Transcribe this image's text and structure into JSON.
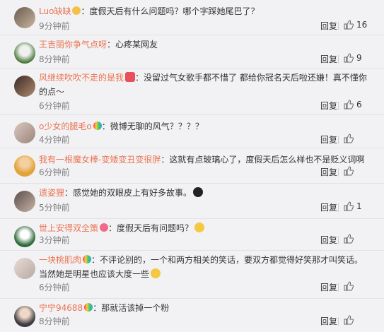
{
  "reply_label": "回复",
  "colors": {
    "username": "#eb7350",
    "time": "#808080",
    "bg": "#f2f2f5"
  },
  "comments": [
    {
      "user": "Luo缺缺",
      "badge": "crown-badge-icon",
      "text": "：度假天后有什么问题吗？哪个字踩她尾巴了？",
      "time": "9分钟前",
      "likes": "16"
    },
    {
      "user": "王吉丽你争气点呀",
      "badge": "",
      "text": "：心疼某网友",
      "time": "8分钟前",
      "likes": "9"
    },
    {
      "user": "风继续吹吹不走的是我",
      "badge": "heart-emoji-icon",
      "text": "：没留过气女歌手都不惜了 都给你冠名天后啦还嫌！真不懂你的点～",
      "time": "6分钟前",
      "likes": "6"
    },
    {
      "user": "o少女的腿毛o",
      "badge": "balloon-badge-icon",
      "text": "：微博无聊的风气？？？？",
      "time": "4分钟前",
      "likes": ""
    },
    {
      "user": "我有一根魔女棒-变矮变丑变很胖",
      "badge": "",
      "text": "：这就有点玻璃心了，度假天后怎么样也不是贬义词啊",
      "time": "6分钟前",
      "likes": ""
    },
    {
      "user": "遗姿狸",
      "badge": "",
      "text": "：感觉她的双眼皮上有好多故事。",
      "emoji": "face-emoji-icon",
      "time": "5分钟前",
      "likes": "1"
    },
    {
      "user": "世上安得双全策",
      "badge": "flower-badge-icon",
      "text": "：度假天后有问题吗？",
      "emoji": "thinking-emoji-icon",
      "time": "3分钟前",
      "likes": ""
    },
    {
      "user": "一块桃肌肉",
      "badge": "balloon-badge-icon",
      "text": "：不评论别的，一个和两方相关的笑话，要双方都觉得好笑那才叫笑话。当然她是明星也应该大度一些",
      "emoji": "cat-emoji-icon",
      "time": "6分钟前",
      "likes": ""
    },
    {
      "user": "宁宁94688",
      "badge": "balloon-badge-icon",
      "text": "：那就活该掉一个粉",
      "time": "8分钟前",
      "likes": ""
    }
  ]
}
